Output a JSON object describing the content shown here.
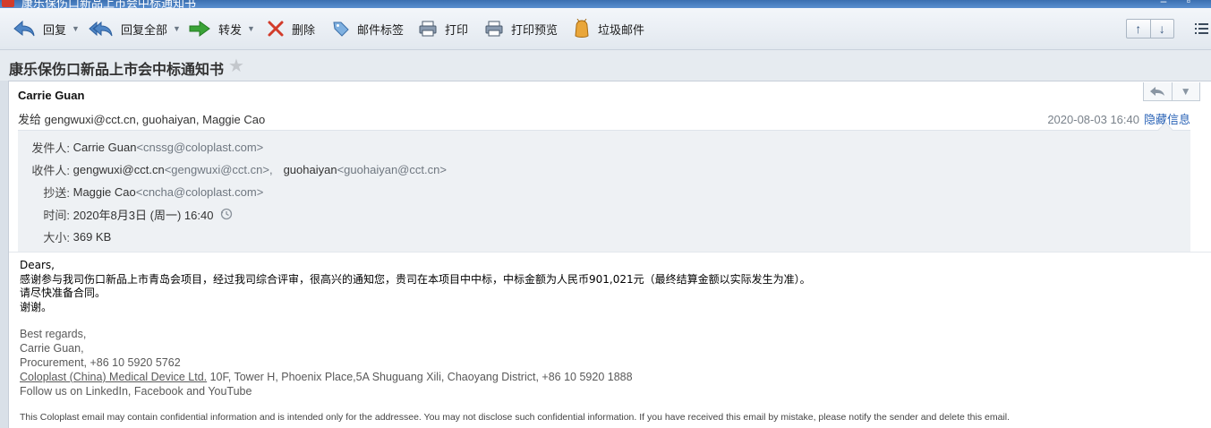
{
  "window": {
    "title": "康乐保伤口新品上市会中标通知书"
  },
  "toolbar": {
    "reply": "回复",
    "reply_all": "回复全部",
    "forward": "转发",
    "delete": "删除",
    "tag": "邮件标签",
    "print": "打印",
    "print_preview": "打印预览",
    "junk": "垃圾邮件"
  },
  "message": {
    "subject": "康乐保伤口新品上市会中标通知书",
    "sender_name": "Carrie Guan",
    "to_summary": "发给 gengwuxi@cct.cn, guohaiyan, Maggie Cao",
    "date_short": "2020-08-03 16:40",
    "hide_details": "隐藏信息",
    "details": {
      "from_label": "发件人:",
      "from_name": "Carrie Guan",
      "from_addr": "<cnssg@coloplast.com>",
      "to_label": "收件人:",
      "to_1_name": "gengwuxi@cct.cn",
      "to_1_addr": "<gengwuxi@cct.cn>,",
      "to_2_name": "guohaiyan",
      "to_2_addr": "<guohaiyan@cct.cn>",
      "cc_label": "抄送:",
      "cc_name": "Maggie Cao",
      "cc_addr": "<cncha@coloplast.com>",
      "time_label": "时间:",
      "time_value": "2020年8月3日 (周一) 16:40",
      "size_label": "大小:",
      "size_value": "369 KB"
    },
    "body": [
      "Dears,",
      "感谢参与我司伤口新品上市青岛会项目，经过我司综合评审，很高兴的通知您，贵司在本项目中中标，中标金额为人民币901,021元（最终结算金额以实际发生为准）。",
      "请尽快准备合同。",
      "谢谢。"
    ],
    "signature": {
      "regards": "Best regards,",
      "name": "Carrie Guan,",
      "dept": "Procurement, +86 10 5920 5762",
      "company": "Coloplast (China) Medical Device Ltd.",
      "address": " 10F, Tower H, Phoenix Place,5A Shuguang Xili, Chaoyang District, +86 10 5920 1888",
      "follow": "Follow us on LinkedIn, Facebook and YouTube"
    },
    "disclaimer": "This Coloplast email may contain confidential information and is intended only for the addressee. You may not disclose such confidential information. If you have received this email by mistake, please notify the sender and delete this email."
  },
  "colors": {
    "accent_link": "#2a63b6",
    "toolbar_bg": "#e2e8ef",
    "forward_green": "#3aa337",
    "delete_red": "#d23b2a"
  }
}
